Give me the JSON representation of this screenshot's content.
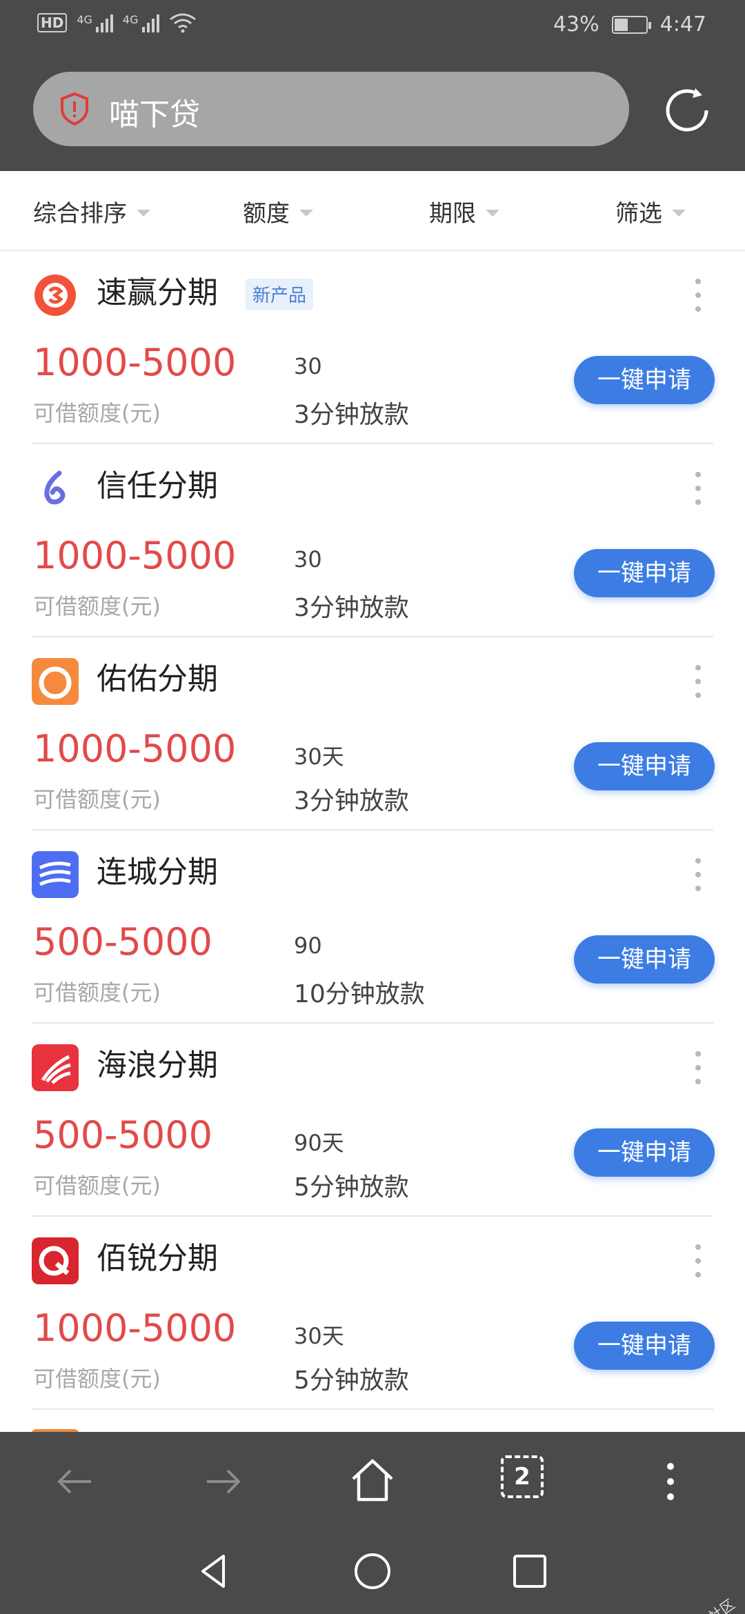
{
  "status_bar": {
    "hd_label": "HD",
    "net_1": "4G",
    "net_2": "4G",
    "battery_percent": "43%",
    "battery_level": 0.43,
    "time": "4:47"
  },
  "search": {
    "value": "喵下贷",
    "shield_icon": "shield-alert-icon",
    "refresh_icon": "refresh-icon"
  },
  "filters": [
    {
      "label": "综合排序"
    },
    {
      "label": "额度"
    },
    {
      "label": "期限"
    },
    {
      "label": "筛选"
    }
  ],
  "products": [
    {
      "name": "速赢分期",
      "tag": "新产品",
      "amount": "1000-5000",
      "amount_label": "可借额度(元)",
      "term": "30",
      "speed": "3分钟放款",
      "button": "一键申请",
      "logo_color": "#f0533a"
    },
    {
      "name": "信任分期",
      "tag": "",
      "amount": "1000-5000",
      "amount_label": "可借额度(元)",
      "term": "30",
      "speed": "3分钟放款",
      "button": "一键申请",
      "logo_color": "#6a6fe0"
    },
    {
      "name": "佑佑分期",
      "tag": "",
      "amount": "1000-5000",
      "amount_label": "可借额度(元)",
      "term": "30天",
      "speed": "3分钟放款",
      "button": "一键申请",
      "logo_color": "#f58a3c"
    },
    {
      "name": "连城分期",
      "tag": "",
      "amount": "500-5000",
      "amount_label": "可借额度(元)",
      "term": "90",
      "speed": "10分钟放款",
      "button": "一键申请",
      "logo_color": "#4e6ef2"
    },
    {
      "name": "海浪分期",
      "tag": "",
      "amount": "500-5000",
      "amount_label": "可借额度(元)",
      "term": "90天",
      "speed": "5分钟放款",
      "button": "一键申请",
      "logo_color": "#e8323e"
    },
    {
      "name": "佰锐分期",
      "tag": "",
      "amount": "1000-5000",
      "amount_label": "可借额度(元)",
      "term": "30天",
      "speed": "5分钟放款",
      "button": "一键申请",
      "logo_color": "#d8262e"
    }
  ],
  "toolbar": {
    "tab_count": "2"
  },
  "watermark": "卡农社区",
  "colors": {
    "accent": "#3d7de3",
    "amount": "#e24a4a",
    "header_bg": "#4a4a4a"
  }
}
